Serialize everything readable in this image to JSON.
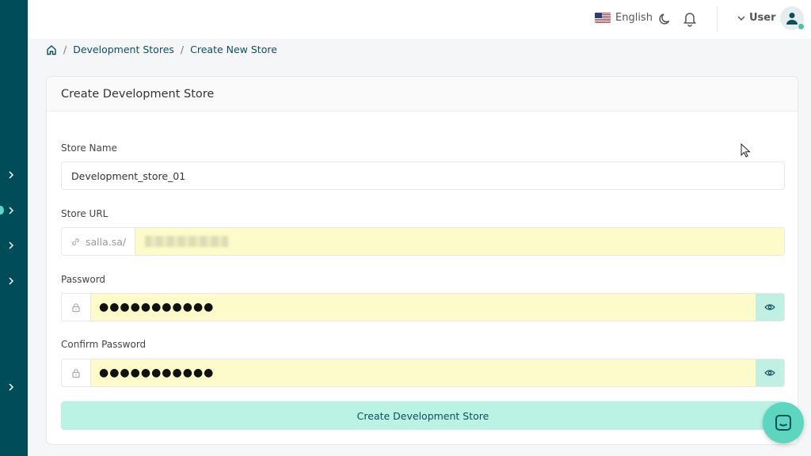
{
  "topbar": {
    "language": "English",
    "user_label": "User"
  },
  "breadcrumb": {
    "items": [
      "Development Stores",
      "Create New Store"
    ]
  },
  "card": {
    "title": "Create Development Store"
  },
  "form": {
    "store_name": {
      "label": "Store Name",
      "value": "Development_store_01"
    },
    "store_url": {
      "label": "Store URL",
      "prefix": "salla.sa/",
      "value": ""
    },
    "password": {
      "label": "Password",
      "value": "●●●●●●●●●●●"
    },
    "confirm_password": {
      "label": "Confirm Password",
      "value": "●●●●●●●●●●●"
    },
    "submit_label": "Create Development Store"
  },
  "colors": {
    "sidebar": "#004d5a",
    "accent": "#baf3e4",
    "autofill": "#fcfbc9",
    "chat": "#5dd6bf"
  },
  "icons": [
    "home-icon",
    "chevron-right-icon",
    "us-flag-icon",
    "moon-icon",
    "bell-icon",
    "chevron-down-icon",
    "user-icon",
    "link-icon",
    "lock-icon",
    "eye-icon",
    "chat-icon",
    "cursor-icon"
  ]
}
